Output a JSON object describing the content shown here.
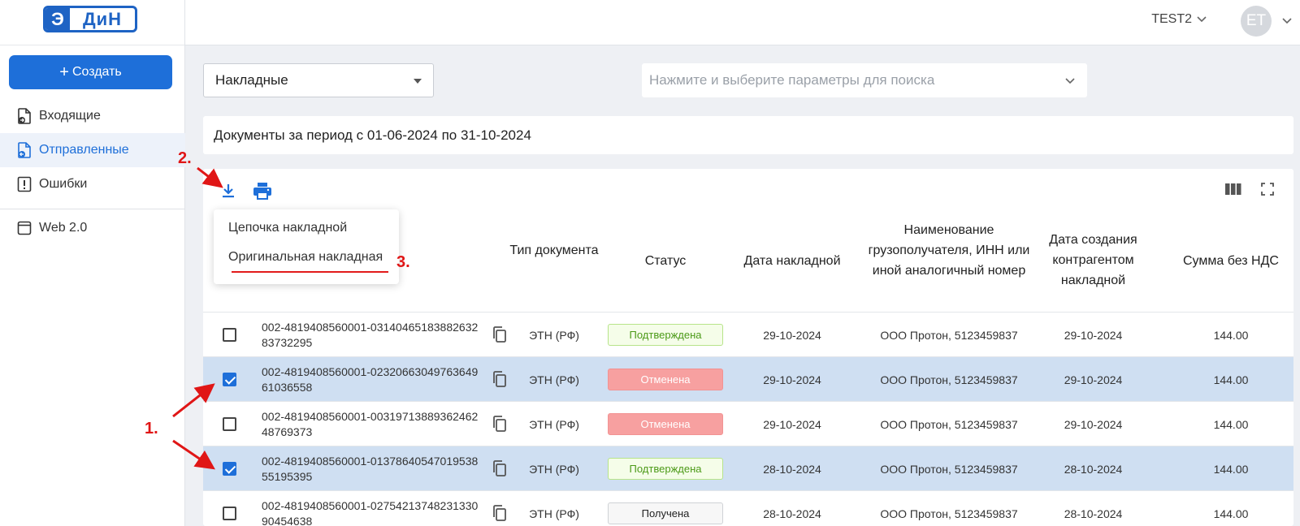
{
  "logo": {
    "left": "Э",
    "right": "ДиН"
  },
  "sidebar": {
    "create_label": "Создать",
    "items": [
      {
        "label": "Входящие",
        "icon": "inbox-doc-icon"
      },
      {
        "label": "Отправленные",
        "icon": "sent-doc-icon",
        "active": true
      },
      {
        "label": "Ошибки",
        "icon": "error-icon"
      },
      {
        "label": "Web 2.0",
        "icon": "window-icon"
      }
    ]
  },
  "header": {
    "account": "TEST2",
    "avatar_initials": "ET"
  },
  "filters": {
    "doc_type": "Накладные",
    "search_placeholder": "Нажмите и выберите параметры для поиска"
  },
  "period_text": "Документы за период с 01-06-2024 по 31-10-2024",
  "download_menu": {
    "items": [
      "Цепочка накладной",
      "Оригинальная накладная"
    ]
  },
  "table": {
    "headers": {
      "type": "Тип документа",
      "status": "Статус",
      "date": "Дата накладной",
      "consignee": "Наименование грузополучателя, ИНН или иной аналогичный номер",
      "created": "Дата создания контрагентом накладной",
      "sum": "Сумма без НДС"
    },
    "rows": [
      {
        "checked": false,
        "num1": "002-4819408560001-03140465183882632",
        "num2": "83732295",
        "type": "ЭТН (РФ)",
        "status": "Подтверждена",
        "status_kind": "ok",
        "date": "29-10-2024",
        "consignee": "ООО Протон, 5123459837",
        "created": "29-10-2024",
        "sum": "144.00"
      },
      {
        "checked": true,
        "num1": "002-4819408560001-02320663049763649",
        "num2": "61036558",
        "type": "ЭТН (РФ)",
        "status": "Отменена",
        "status_kind": "cancel",
        "date": "29-10-2024",
        "consignee": "ООО Протон, 5123459837",
        "created": "29-10-2024",
        "sum": "144.00"
      },
      {
        "checked": false,
        "num1": "002-4819408560001-00319713889362462",
        "num2": "48769373",
        "type": "ЭТН (РФ)",
        "status": "Отменена",
        "status_kind": "cancel",
        "date": "29-10-2024",
        "consignee": "ООО Протон, 5123459837",
        "created": "29-10-2024",
        "sum": "144.00"
      },
      {
        "checked": true,
        "num1": "002-4819408560001-01378640547019538",
        "num2": "55195395",
        "type": "ЭТН (РФ)",
        "status": "Подтверждена",
        "status_kind": "ok",
        "date": "28-10-2024",
        "consignee": "ООО Протон, 5123459837",
        "created": "28-10-2024",
        "sum": "144.00"
      },
      {
        "checked": false,
        "num1": "002-4819408560001-02754213748231330",
        "num2": "90454638",
        "type": "ЭТН (РФ)",
        "status": "Получена",
        "status_kind": "got",
        "date": "28-10-2024",
        "consignee": "ООО Протон, 5123459837",
        "created": "28-10-2024",
        "sum": "144.00"
      }
    ]
  },
  "annotations": {
    "step1": "1.",
    "step2": "2.",
    "step3": "3."
  },
  "colors": {
    "accent": "#1e6fd9",
    "selected_row": "#cfdff2",
    "annotation": "#e01616"
  }
}
